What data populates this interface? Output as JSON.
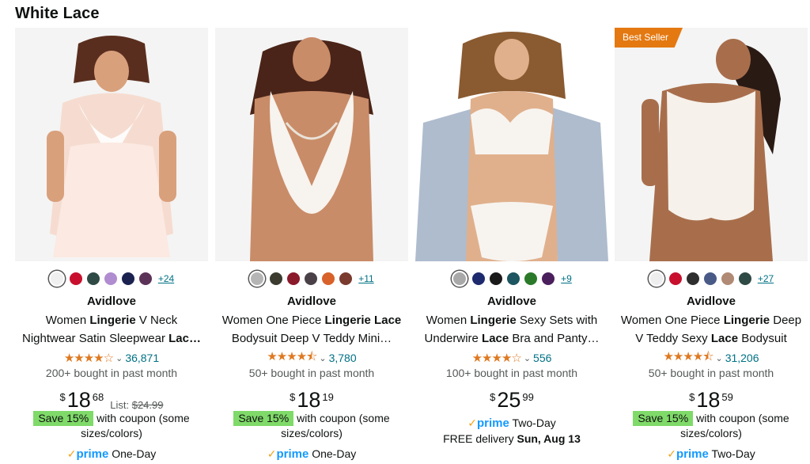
{
  "section_title": "White Lace",
  "colors": {
    "star": "#de7921",
    "link": "#007185",
    "coupon_green": "#7fda69",
    "badge_orange": "#e47911",
    "prime_blue": "#1399ff"
  },
  "products": [
    {
      "brand": "Avidlove",
      "title_line1": [
        "Women ",
        "Lingerie",
        " V Neck"
      ],
      "title_line2": [
        "Nightwear Satin Sleepwear ",
        "Lac…",
        ""
      ],
      "swatches": [
        "#f0f0f0",
        "#c8102e",
        "#2f4a44",
        "#b08cd0",
        "#1b2250",
        "#5c3358"
      ],
      "more_colors": "+24",
      "rating_stars": 4.0,
      "rating_count": "36,871",
      "bought": "200+ bought in past month",
      "price_symbol": "$",
      "price_whole": "18",
      "price_fraction": "68",
      "list_label": "List: ",
      "list_price": "$24.99",
      "coupon_badge": "Save 15%",
      "coupon_text": "with coupon (some sizes/colors)",
      "prime_delivery": "One-Day",
      "badge": ""
    },
    {
      "brand": "Avidlove",
      "title_line1": [
        "Women One Piece ",
        "Lingerie Lace",
        ""
      ],
      "title_line2": [
        "Bodysuit Deep V Teddy Mini…",
        "",
        ""
      ],
      "swatches": [
        "#b5b5b5",
        "#3b3b30",
        "#8b1a2b",
        "#4a4148",
        "#d8622a",
        "#7a3a2e"
      ],
      "more_colors": "+11",
      "rating_stars": 4.5,
      "rating_count": "3,780",
      "bought": "50+ bought in past month",
      "price_symbol": "$",
      "price_whole": "18",
      "price_fraction": "19",
      "list_label": "",
      "list_price": "",
      "coupon_badge": "Save 15%",
      "coupon_text": "with coupon (some sizes/colors)",
      "prime_delivery": "One-Day",
      "badge": ""
    },
    {
      "brand": "Avidlove",
      "title_line1": [
        "Women ",
        "Lingerie",
        " Sexy Sets with"
      ],
      "title_line2": [
        "Underwire ",
        "Lace",
        " Bra and Panty…"
      ],
      "swatches": [
        "#a9a9a9",
        "#1e2a6e",
        "#1a1a1a",
        "#1d5560",
        "#2a7a2a",
        "#4a1f5c"
      ],
      "more_colors": "+9",
      "rating_stars": 4.0,
      "rating_count": "556",
      "bought": "100+ bought in past month",
      "price_symbol": "$",
      "price_whole": "25",
      "price_fraction": "99",
      "list_label": "",
      "list_price": "",
      "coupon_badge": "",
      "coupon_text": "",
      "prime_delivery": "Two-Day",
      "delivery_text": "FREE delivery ",
      "delivery_date": "Sun, Aug 13",
      "badge": ""
    },
    {
      "brand": "Avidlove",
      "title_line1": [
        "Women One Piece ",
        "Lingerie",
        " Deep"
      ],
      "title_line2": [
        "V Teddy Sexy ",
        "Lace",
        " Bodysuit"
      ],
      "swatches": [
        "#eeeeee",
        "#c8102e",
        "#2e2e2e",
        "#4a5a86",
        "#b08a74",
        "#2f4a44"
      ],
      "more_colors": "+27",
      "rating_stars": 4.5,
      "rating_count": "31,206",
      "bought": "50+ bought in past month",
      "price_symbol": "$",
      "price_whole": "18",
      "price_fraction": "59",
      "list_label": "",
      "list_price": "",
      "coupon_badge": "Save 15%",
      "coupon_text": "with coupon (some sizes/colors)",
      "prime_delivery": "Two-Day",
      "badge": "Best Seller"
    }
  ],
  "prime_label": "prime",
  "prime_check": "✓"
}
